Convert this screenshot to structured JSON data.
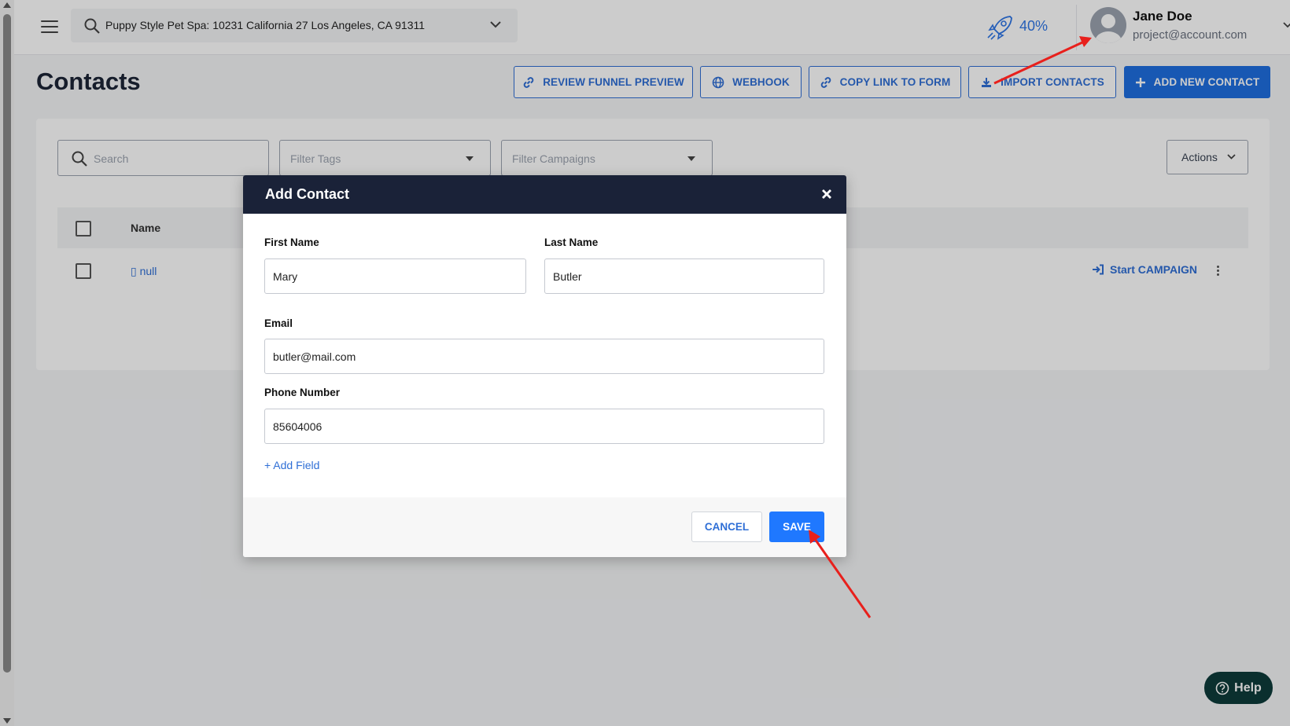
{
  "topbar": {
    "location": "Puppy Style Pet Spa: 10231 California 27 Los Angeles, CA 91311",
    "progress": "40%",
    "user_name": "Jane Doe",
    "user_email": "project@account.com"
  },
  "page": {
    "title": "Contacts",
    "buttons": {
      "review_funnel": "REVIEW FUNNEL PREVIEW",
      "webhook": "WEBHOOK",
      "copy_link": "COPY LINK TO FORM",
      "import_contacts": "IMPORT CONTACTS",
      "add_new_contact": "ADD NEW CONTACT"
    }
  },
  "filters": {
    "search_placeholder": "Search",
    "tags_placeholder": "Filter Tags",
    "campaigns_placeholder": "Filter Campaigns",
    "actions_label": "Actions"
  },
  "table": {
    "columns": [
      "Name"
    ],
    "rows": [
      {
        "name": "▯ null",
        "action": "Start CAMPAIGN"
      }
    ]
  },
  "modal": {
    "title": "Add Contact",
    "first_name_label": "First Name",
    "first_name_value": "Mary",
    "last_name_label": "Last Name",
    "last_name_value": "Butler",
    "email_label": "Email",
    "email_value": "butler@mail.com",
    "phone_label": "Phone Number",
    "phone_value": "85604006",
    "add_field": "+ Add Field",
    "cancel": "CANCEL",
    "save": "SAVE"
  },
  "help": {
    "label": "Help"
  },
  "colors": {
    "accent": "#1f6fe0",
    "modal_header": "#1a2238",
    "help_bg": "#0d3b3a",
    "annotation": "#e8201c"
  }
}
